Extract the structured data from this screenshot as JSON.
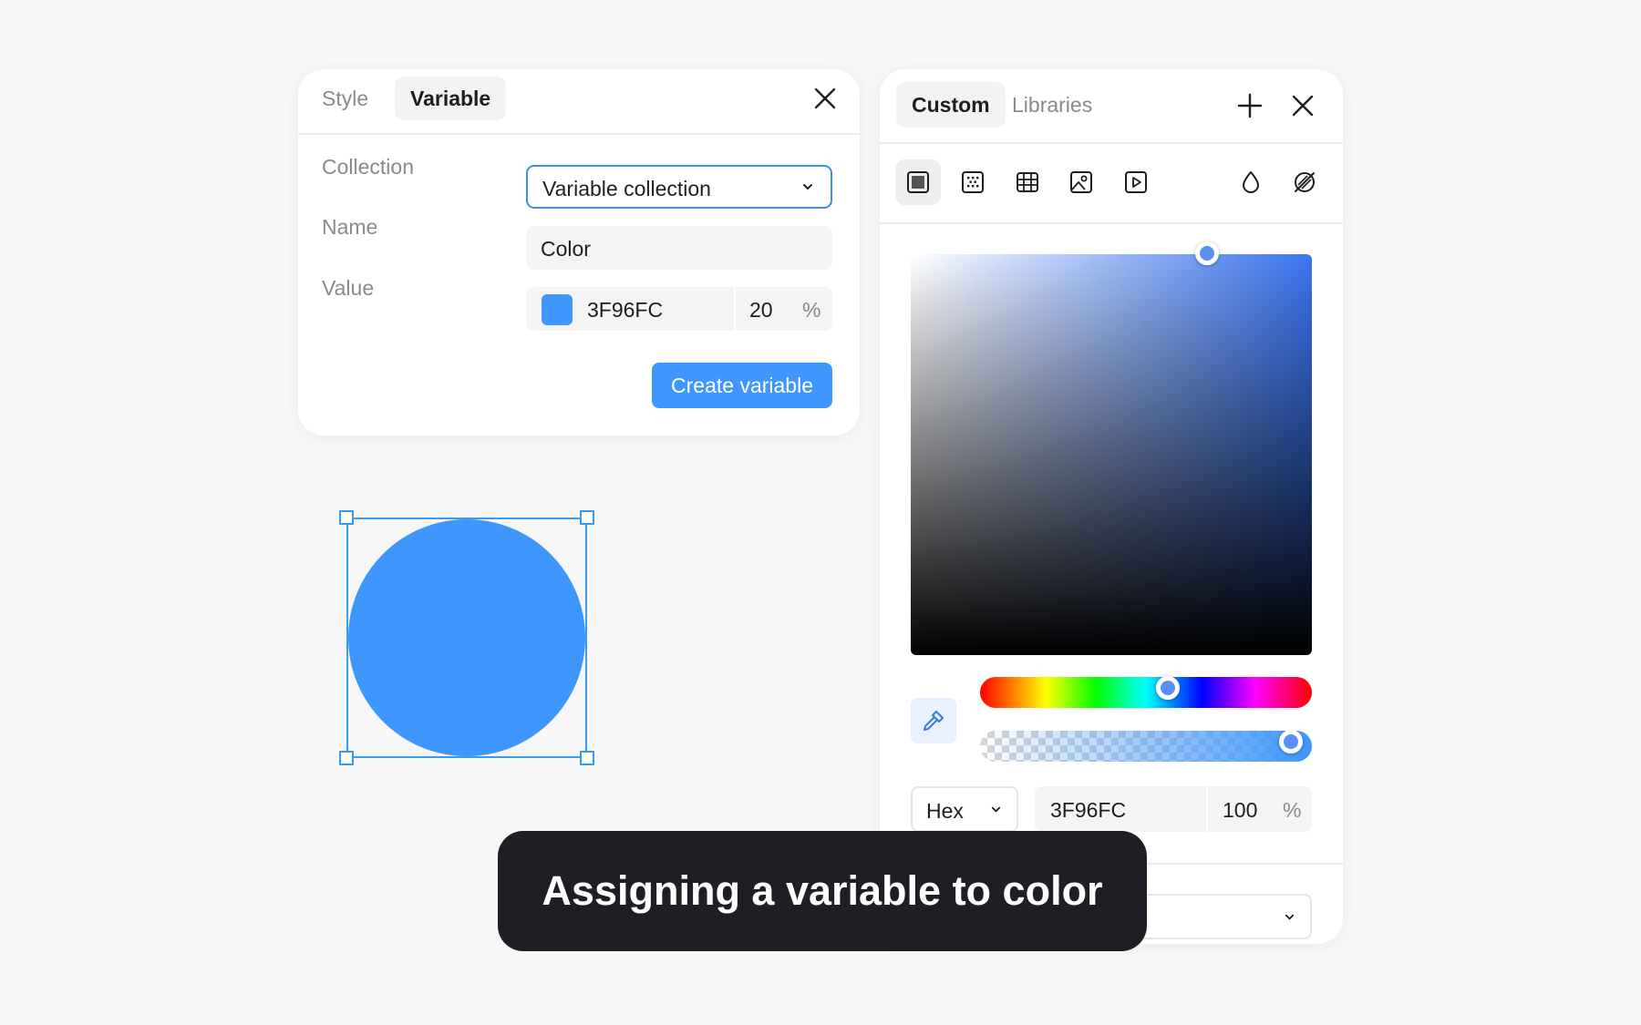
{
  "variable_panel": {
    "tabs": [
      {
        "label": "Style",
        "active": false
      },
      {
        "label": "Variable",
        "active": true
      }
    ],
    "fields": {
      "collection_label": "Collection",
      "collection_value": "Variable collection",
      "name_label": "Name",
      "name_value": "Color",
      "value_label": "Value",
      "value_hex": "3F96FC",
      "value_opacity": "20",
      "value_percent": "%"
    },
    "create_button": "Create variable",
    "swatch_color": "#3F96FC"
  },
  "canvas": {
    "shape": "ellipse",
    "fill": "#3F96FC",
    "selection_color": "#3A9BEA"
  },
  "color_picker": {
    "tabs": [
      {
        "label": "Custom",
        "active": true
      },
      {
        "label": "Libraries",
        "active": false
      }
    ],
    "fill_types": [
      "solid-fill-icon",
      "gradient-fill-icon",
      "pattern-fill-icon",
      "image-fill-icon",
      "video-fill-icon"
    ],
    "extra_icons": [
      "blend-mode-icon",
      "hide-fill-icon"
    ],
    "format": "Hex",
    "hex": "3F96FC",
    "opacity": "100",
    "percent": "%",
    "hue_position": 0.58,
    "alpha_position": 1.0,
    "saturation": 0.75,
    "brightness": 0.99
  },
  "caption": "Assigning a variable to color",
  "colors": {
    "accent": "#3F96FC",
    "caption_bg": "#1E1F24",
    "background": "#F7F7F7"
  }
}
